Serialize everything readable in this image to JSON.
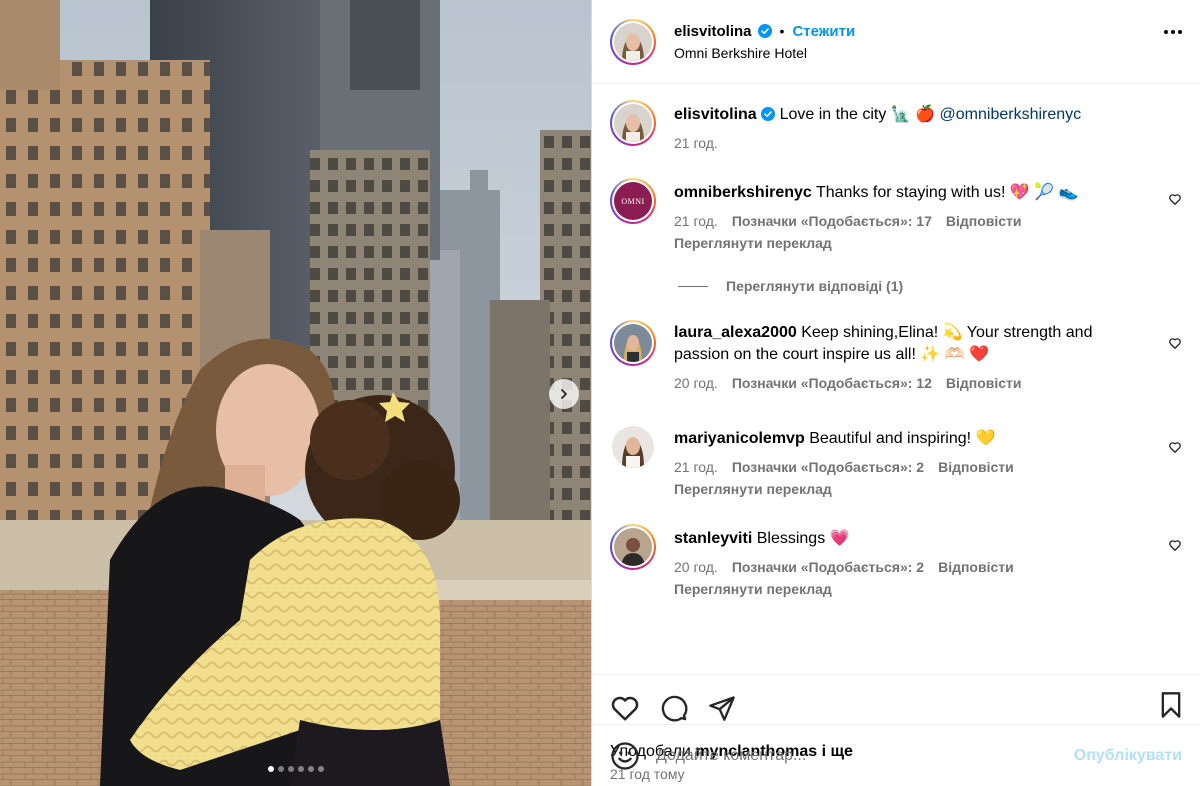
{
  "post": {
    "username": "elisvitolina",
    "follow_label": "Стежити",
    "separator": "•",
    "location": "Omni Berkshire Hotel",
    "caption": "Love in the city 🗽 🍎",
    "caption_mention": "@omniberkshirenyc",
    "caption_time": "21 год.",
    "carousel": {
      "total": 6,
      "current": 1
    }
  },
  "comments": [
    {
      "username": "omniberkshirenyc",
      "text": "Thanks for staying with us! 💖 🎾 👟",
      "time": "21 год.",
      "likes": "Позначки «Подобається»: 17",
      "reply": "Відповісти",
      "translate": "Переглянути переклад",
      "avatar_text": "OMNI"
    },
    {
      "username": "laura_alexa2000",
      "text": "Keep shining,Elina! 💫 Your strength and passion on the court inspire us all! ✨ 🫶🏻 ❤️",
      "time": "20 год.",
      "likes": "Позначки «Подобається»: 12",
      "reply": "Відповісти"
    },
    {
      "username": "mariyanicolemvp",
      "text": "Beautiful and inspiring! 💛",
      "time": "21 год.",
      "likes": "Позначки «Подобається»: 2",
      "reply": "Відповісти",
      "translate": "Переглянути переклад"
    },
    {
      "username": "stanleyviti",
      "text": "Blessings 💗",
      "time": "20 год.",
      "likes": "Позначки «Подобається»: 2",
      "reply": "Відповісти",
      "translate": "Переглянути переклад"
    }
  ],
  "view_replies": "Переглянути відповіді (1)",
  "liked_by": {
    "prefix": "Уподобали",
    "user": "mynclanthomas",
    "suffix": "і ще"
  },
  "post_time_ago": "21 год тому",
  "composer": {
    "placeholder": "Додайте коментар...",
    "publish_label": "Опублікувати"
  },
  "icons": {
    "verified": "verified-badge-icon",
    "more": "more-options-icon",
    "like": "heart-icon",
    "comment": "comment-icon",
    "share": "send-icon",
    "save": "bookmark-icon",
    "emoji": "emoji-icon",
    "next": "chevron-right-icon"
  },
  "colors": {
    "link": "#0095f6",
    "muted": "#737373",
    "verified": "#0095f6",
    "publish_disabled": "#b2dffc"
  }
}
